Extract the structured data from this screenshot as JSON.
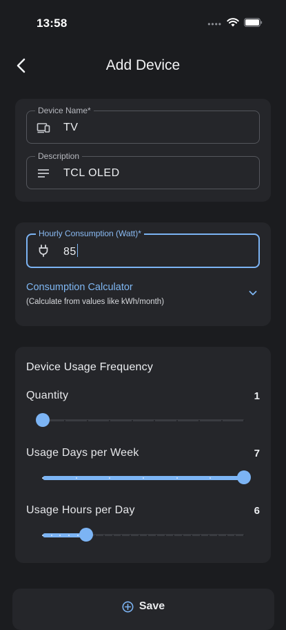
{
  "status_bar": {
    "time": "13:58",
    "dots": "••••",
    "icons": [
      "wifi-icon",
      "battery-icon"
    ]
  },
  "header": {
    "title": "Add Device",
    "back_icon": "chevron-left-icon"
  },
  "device_card": {
    "name_field": {
      "label": "Device Name*",
      "value": "TV",
      "icon": "devices-icon"
    },
    "description_field": {
      "label": "Description",
      "value": "TCL OLED",
      "icon": "notes-icon"
    }
  },
  "consumption_card": {
    "hourly_field": {
      "label": "Hourly Consumption (Watt)*",
      "value": "85",
      "icon": "plug-icon"
    },
    "calculator": {
      "title": "Consumption Calculator",
      "subtitle": "(Calculate from values like kWh/month)",
      "icon": "chevron-down-icon"
    }
  },
  "frequency_card": {
    "title": "Device Usage Frequency",
    "rows": [
      {
        "label": "Quantity",
        "value": "1",
        "min": 1,
        "max": 10,
        "level": 1
      },
      {
        "label": "Usage Days per Week",
        "value": "7",
        "min": 1,
        "max": 7,
        "level": 7
      },
      {
        "label": "Usage Hours per Day",
        "value": "6",
        "min": 1,
        "max": 24,
        "level": 6
      }
    ]
  },
  "save_button": {
    "label": "Save",
    "icon": "add-circle-icon"
  },
  "colors": {
    "accent": "#7cb4f4",
    "background": "#1b1c1f",
    "card": "#25262a"
  }
}
